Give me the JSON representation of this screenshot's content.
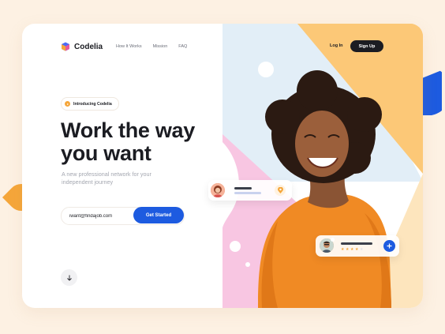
{
  "brand": {
    "name": "Codelia"
  },
  "nav": {
    "items": [
      {
        "label": "How It Works"
      },
      {
        "label": "Mission"
      },
      {
        "label": "FAQ"
      }
    ]
  },
  "auth": {
    "login_label": "Log In",
    "signup_label": "Sign Up"
  },
  "hero": {
    "badge": "Introducing Codelia",
    "headline_line1": "Work the way",
    "headline_line2": "you want",
    "subtitle": "A new professional network for your independent journey",
    "email_value": "iwant@findajob.com",
    "cta_label": "Get Started"
  },
  "profile_card_2": {
    "rating_stars": 4,
    "rating_max": 5
  },
  "colors": {
    "accent_blue": "#1d5be0",
    "accent_orange": "#f5a63a",
    "dark": "#1b1c22",
    "pink": "#f8c4e1",
    "yellow": "#fcc877",
    "light_blue": "#dfeef7"
  },
  "icons": [
    "logo-icon",
    "play-icon",
    "arrow-down-icon",
    "location-pin-icon",
    "plus-icon",
    "star-icon"
  ]
}
